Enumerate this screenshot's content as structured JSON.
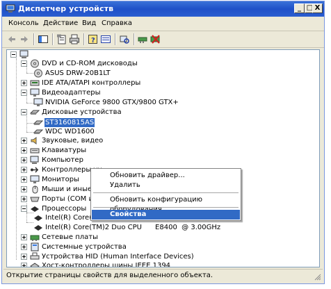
{
  "window": {
    "title": "Диспетчер устройств"
  },
  "titlebar_buttons": {
    "minimize": "_",
    "maximize": "□",
    "close": "X"
  },
  "menu": [
    "Консоль",
    "Действие",
    "Вид",
    "Справка"
  ],
  "toolbar": {
    "icons": [
      "back-arrow-icon",
      "forward-arrow-icon",
      "show-hide-tree-icon",
      "properties-icon",
      "print-icon",
      "help-icon",
      "view-icon",
      "scan-hardware-icon",
      "update-driver-icon",
      "uninstall-icon"
    ]
  },
  "tree": {
    "root": "",
    "categories": [
      {
        "label": "DVD и CD-ROM дисководы",
        "expanded": true,
        "children": [
          "ASUS DRW-20B1LT"
        ]
      },
      {
        "label": "IDE ATA/ATAPI контроллеры",
        "expanded": false
      },
      {
        "label": "Видеоадаптеры",
        "expanded": true,
        "children": [
          "NVIDIA GeForce 9800 GTX/9800 GTX+"
        ]
      },
      {
        "label": "Дисковые устройства",
        "expanded": true,
        "children": [
          "ST3160815AS",
          "WDC WD1600"
        ]
      },
      {
        "label": "Звуковые, видео",
        "expanded": false
      },
      {
        "label": "Клавиатуры",
        "expanded": false
      },
      {
        "label": "Компьютер",
        "expanded": false
      },
      {
        "label": "Контроллеры ун",
        "expanded": false
      },
      {
        "label": "Мониторы",
        "expanded": false
      },
      {
        "label": "Мыши и иные указывающие устройства",
        "expanded": false
      },
      {
        "label": "Порты (COM и LPT)",
        "expanded": false
      },
      {
        "label": "Процессоры",
        "expanded": true,
        "children": [
          "Intel(R) Core(TM)2 Duo CPU      E8400  @ 3.00GHz",
          "Intel(R) Core(TM)2 Duo CPU      E8400  @ 3.00GHz"
        ]
      },
      {
        "label": "Сетевые платы",
        "expanded": false
      },
      {
        "label": "Системные устройства",
        "expanded": false
      },
      {
        "label": "Устройства HID (Human Interface Devices)",
        "expanded": false
      },
      {
        "label": "Хост-контроллеры шины IEEE 1394",
        "expanded": false
      }
    ]
  },
  "context_menu": {
    "items": [
      "Обновить драйвер...",
      "Удалить",
      "Обновить конфигурацию оборудования",
      "Свойства"
    ],
    "highlighted": "Свойства"
  },
  "status": {
    "text": "Открытие страницы свойств для выделенного объекта."
  },
  "colors": {
    "title_blue": "#1f50c8",
    "selection": "#316ac5",
    "chrome": "#ece9d8"
  }
}
